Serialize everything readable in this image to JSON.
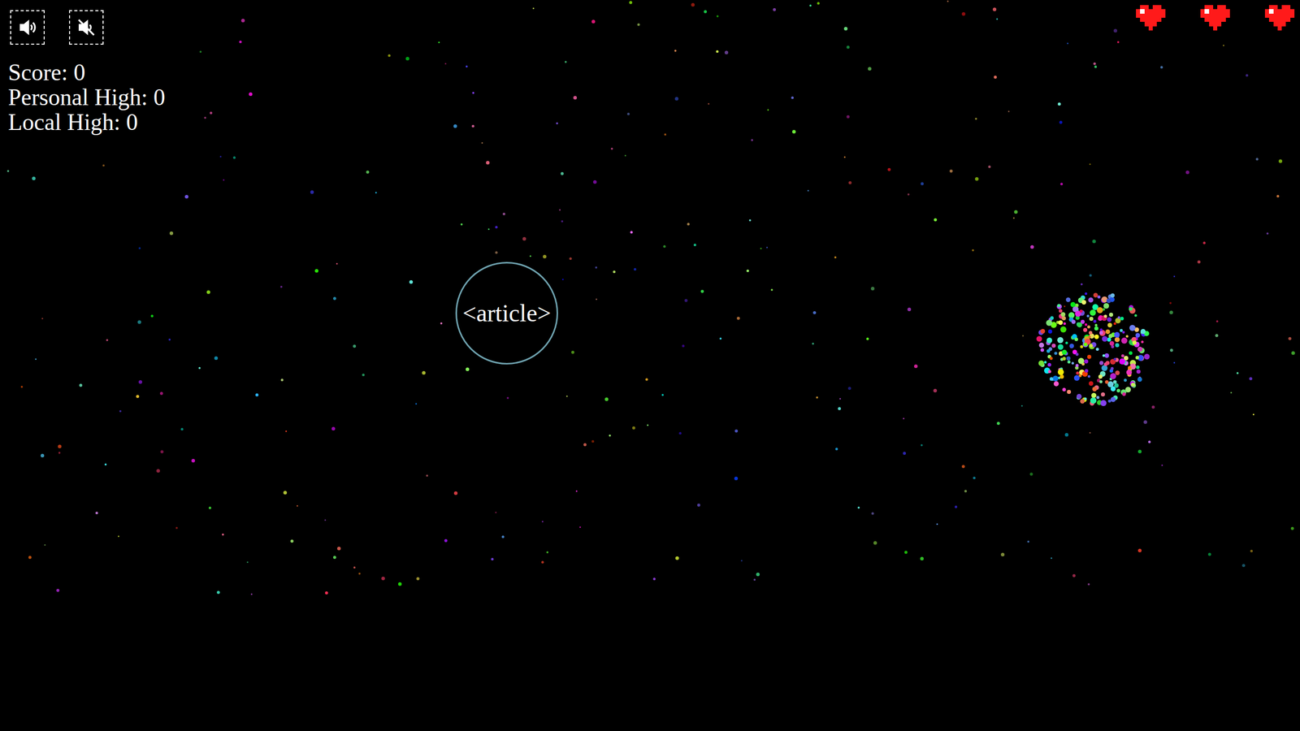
{
  "hud": {
    "score": "Score: 0",
    "personal_high": "Personal High: 0",
    "local_high": "Local High: 0"
  },
  "sound": [
    {
      "label": "sound-on",
      "selected": false
    },
    {
      "label": "sound-off",
      "selected": false
    }
  ],
  "lives": [
    {
      "filled": true
    },
    {
      "filled": true
    },
    {
      "filled": true
    }
  ],
  "target": {
    "label": "<article>"
  }
}
